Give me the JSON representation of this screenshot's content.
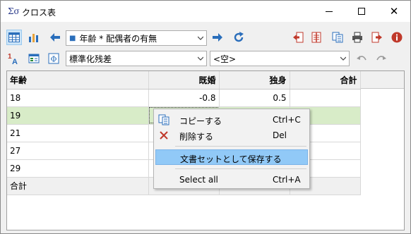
{
  "window": {
    "icon_glyph": "Σσ",
    "title": "クロス表",
    "minimize_icon": "minimize-icon",
    "maximize_icon": "maximize-icon",
    "close_glyph": "✕"
  },
  "toolbar1": {
    "table_view_icon": "table-icon",
    "chart_view_icon": "bar-chart-icon",
    "back_icon": "arrow-left-icon",
    "forward_icon": "arrow-right-icon",
    "refresh_icon": "refresh-icon",
    "variable_combo": {
      "bullet": "■",
      "value": "年齢 * 配偶者の有無"
    },
    "right_icons": [
      "import-icon",
      "split-icon",
      "copy-icon",
      "print-icon",
      "export-icon",
      "info-icon"
    ]
  },
  "toolbar2": {
    "sort_icon_glyph": "1A",
    "stat_combo": {
      "value": "標準化残差"
    },
    "filter_combo": {
      "value": "<空>"
    },
    "undo_icon": "undo-icon",
    "redo_icon": "redo-icon"
  },
  "table": {
    "headers": [
      "年齢",
      "既婚",
      "独身",
      "合計"
    ],
    "rows": [
      [
        "18",
        "-0.8",
        "0.5",
        ""
      ],
      [
        "19",
        "",
        "",
        ""
      ],
      [
        "21",
        "",
        "",
        ""
      ],
      [
        "27",
        "",
        "",
        ""
      ],
      [
        "29",
        "",
        "",
        ""
      ],
      [
        "合計",
        "",
        "",
        ""
      ]
    ]
  },
  "context_menu": {
    "items": [
      {
        "icon": "copy-icon",
        "label": "コピーする",
        "shortcut": "Ctrl+C"
      },
      {
        "icon": "delete-icon",
        "label": "削除する",
        "shortcut": "Del"
      },
      {
        "icon": "",
        "label": "文書セットとして保存する",
        "shortcut": ""
      },
      {
        "icon": "",
        "label": "Select all",
        "shortcut": "Ctrl+A"
      }
    ]
  },
  "colors": {
    "selected_row": "#d8ecc8",
    "menu_highlight": "#91c9f7",
    "accent_red": "#c0392b",
    "accent_blue": "#2a6ebb"
  }
}
